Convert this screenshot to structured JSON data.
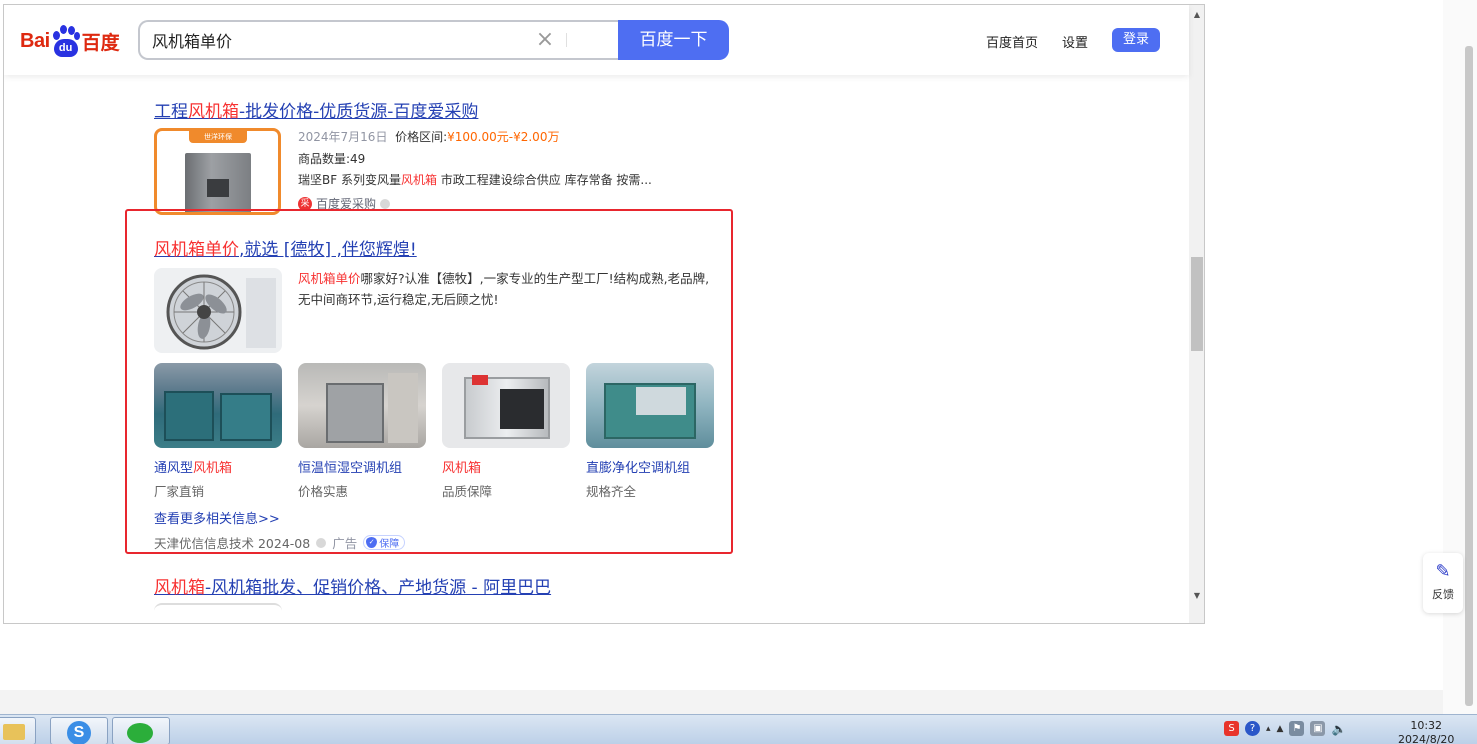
{
  "header": {
    "logo_text_bai": "Bai",
    "logo_text_du": "du",
    "logo_text_cn": "百度",
    "search_value": "风机箱单价",
    "search_button": "百度一下",
    "nav_home": "百度首页",
    "nav_settings": "设置",
    "login_button": "登录"
  },
  "result1": {
    "title_pre": "工程",
    "title_em": "风机箱",
    "title_post": "-批发价格-优质货源-百度爱采购",
    "thumb_badge": "世洋环保",
    "date": "2024年7月16日",
    "price_label": "价格区间:",
    "price_range": "¥100.00元-¥2.00万",
    "count": "商品数量:49",
    "desc_pre": "瑞坚BF 系列变风量",
    "desc_em": "风机箱",
    "desc_post": " 市政工程建设综合供应 库存常备 按需...",
    "source": "百度爱采购"
  },
  "ad": {
    "title_em": "风机箱单价",
    "title_post": ",就选 [德牧] ,伴您辉煌!",
    "desc_em": "风机箱单价",
    "desc_post": "哪家好?认准【德牧】,一家专业的生产型工厂!结构成熟,老品牌,无中间商环节,运行稳定,无后顾之忧!",
    "products": [
      {
        "label_pre": "通风型",
        "label_em": "风机箱",
        "sub": "厂家直销"
      },
      {
        "label_pre": "恒温恒湿空调机组",
        "label_em": "",
        "sub": "价格实惠"
      },
      {
        "label_pre": "",
        "label_em": "风机箱",
        "sub": "品质保障"
      },
      {
        "label_pre": "直膨净化空调机组",
        "label_em": "",
        "sub": "规格齐全"
      }
    ],
    "more_link": "查看更多相关信息>>",
    "advertiser": "天津优信信息技术 2024-08",
    "ad_tag": "广告",
    "badge": "保障"
  },
  "result3": {
    "title_em": "风机箱",
    "title_post": "-风机箱批发、促销价格、产地货源 - 阿里巴巴"
  },
  "feedback": {
    "label": "反馈"
  },
  "taskbar": {
    "time": "10:32",
    "date": "2024/8/20"
  },
  "colors": {
    "accent": "#4e6ef2",
    "link": "#2440b3",
    "highlight": "#f73131",
    "box": "#e8262e"
  }
}
